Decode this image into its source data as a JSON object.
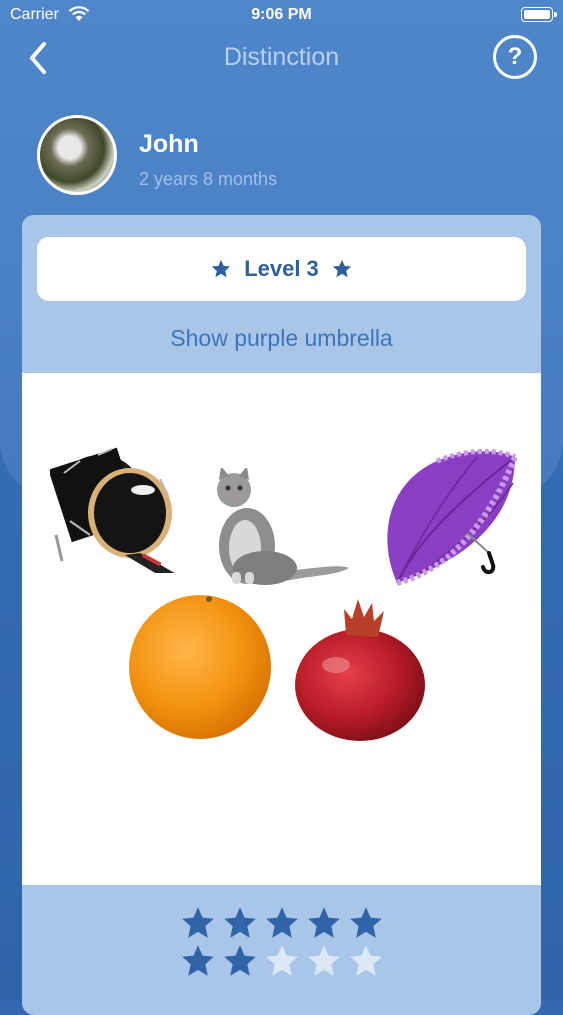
{
  "status": {
    "carrier": "Carrier",
    "time": "9:06 PM"
  },
  "nav": {
    "title": "Distinction",
    "help": "?"
  },
  "profile": {
    "name": "John",
    "age": "2 years 8 months"
  },
  "level": {
    "label": "Level 3"
  },
  "task": {
    "instruction": "Show purple umbrella"
  },
  "items": [
    {
      "name": "bass drum"
    },
    {
      "name": "cat"
    },
    {
      "name": "purple umbrella"
    },
    {
      "name": "orange"
    },
    {
      "name": "pomegranate"
    }
  ],
  "rating": {
    "filled": 7,
    "total": 10
  },
  "colors": {
    "accent": "#2f5f9d",
    "star_filled": "#2f64a9",
    "star_empty": "#dde8f5"
  }
}
